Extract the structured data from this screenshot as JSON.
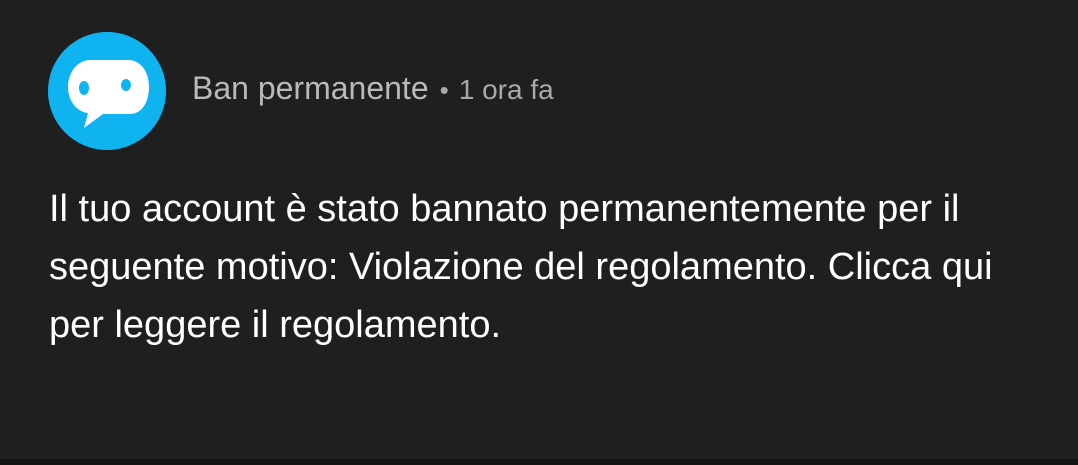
{
  "notification": {
    "title": "Ban permanente",
    "separator": "•",
    "time": "1 ora fa",
    "message": "Il tuo account è stato bannato permanentemente per il seguente motivo: Violazione del regolamento. Clicca qui per leggere il regolamento.",
    "avatar_icon": "speech-bubble-face-icon",
    "colors": {
      "background": "#1f1f1f",
      "avatar": "#0fb3f0",
      "title": "#b9b9b9",
      "time": "#a9a9a9",
      "message": "#ffffff"
    }
  }
}
